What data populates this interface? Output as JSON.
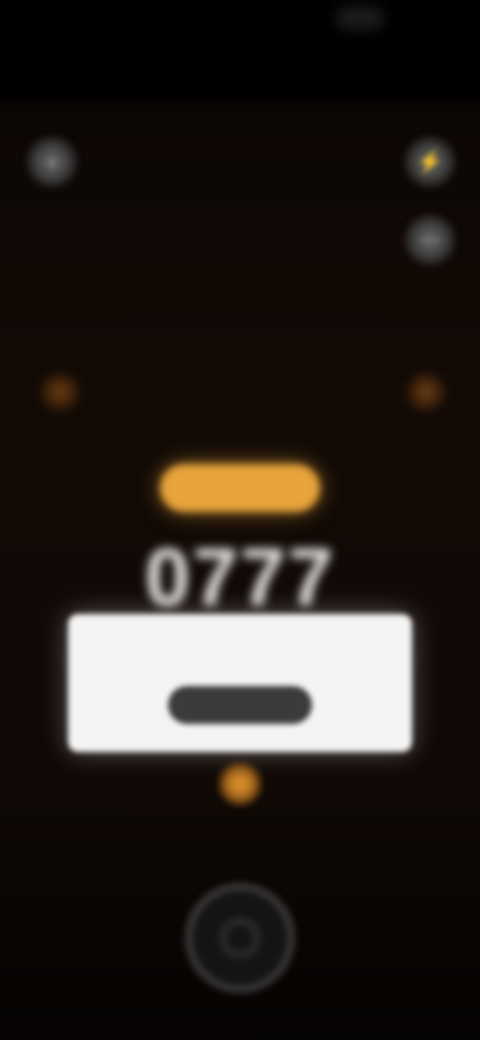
{
  "status_bar": {
    "time": "",
    "icons": [
      "signal-icon",
      "battery-icon"
    ]
  },
  "controls": {
    "back_icon": "back-icon",
    "flash_icon": "flash-icon",
    "more_icon": "more-icon"
  },
  "scanner": {
    "pill_label": "",
    "code": "0777",
    "accent_color": "#e7a43a"
  },
  "toast": {
    "message": "",
    "button_label": ""
  },
  "shutter": {
    "icon": "shutter-icon"
  }
}
